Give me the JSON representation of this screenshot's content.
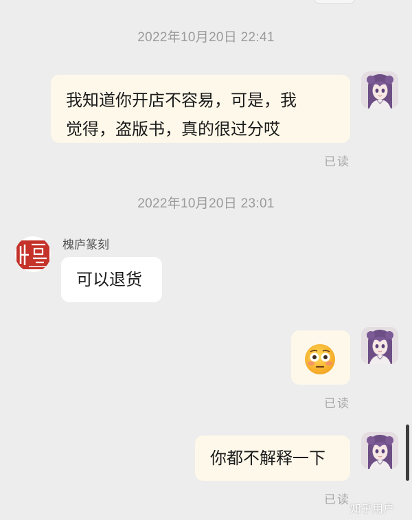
{
  "messages": {
    "ts1": "2022年10月20日 22:41",
    "msg1_line1": "我知道你开店不容易，可是，我",
    "msg1_line2": "觉得，盗版书，真的很过分哎",
    "read1": "已读",
    "ts2": "2022年10月20日 23:01",
    "sender_name": "槐庐篆刻",
    "msg2": "可以退货",
    "emoji_name": "flushed-face",
    "read2": "已读",
    "msg3": "你都不解释一下",
    "read3": "已读"
  },
  "watermark": "知乎用户",
  "colors": {
    "background": "#ededed",
    "my_bubble": "#fdf8ea",
    "their_bubble": "#ffffff",
    "seal_red": "#c4322a"
  },
  "icons": {
    "self_avatar": "anime-girl-avatar",
    "other_avatar": "red-seal-stamp-avatar",
    "emoji": "flushed-face-emoji"
  }
}
